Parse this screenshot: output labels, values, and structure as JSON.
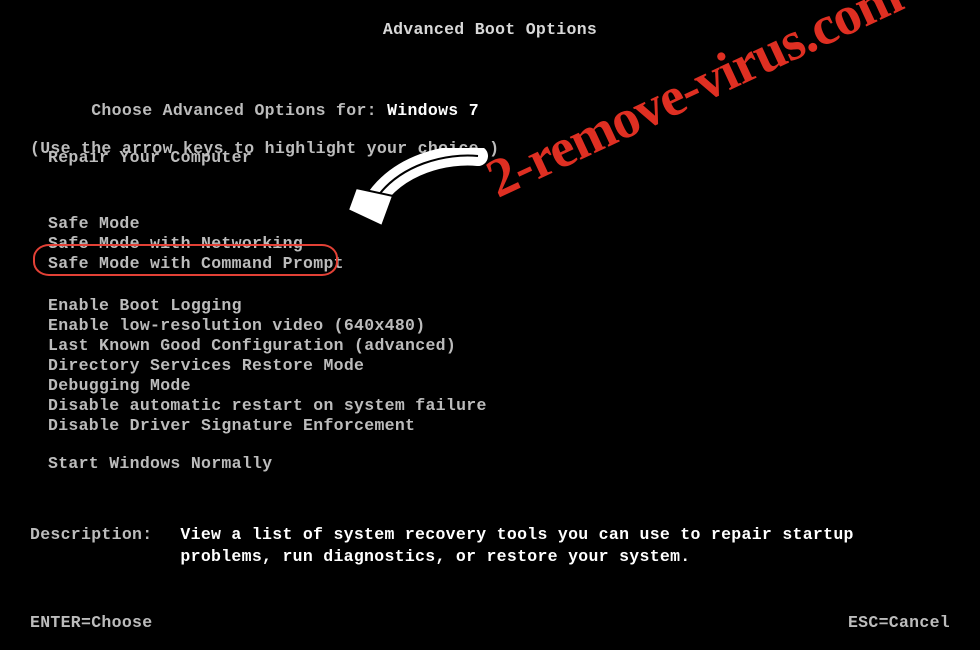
{
  "title": "Advanced Boot Options",
  "intro": {
    "line1_prefix": "Choose Advanced Options for: ",
    "os": "Windows 7",
    "line2": "(Use the arrow keys to highlight your choice.)"
  },
  "groups": {
    "repair": "Repair Your Computer",
    "safe": [
      "Safe Mode",
      "Safe Mode with Networking",
      "Safe Mode with Command Prompt"
    ],
    "misc": [
      "Enable Boot Logging",
      "Enable low-resolution video (640x480)",
      "Last Known Good Configuration (advanced)",
      "Directory Services Restore Mode",
      "Debugging Mode",
      "Disable automatic restart on system failure",
      "Disable Driver Signature Enforcement"
    ],
    "normal": "Start Windows Normally"
  },
  "description": {
    "label": "Description:",
    "text": "View a list of system recovery tools you can use to repair startup problems, run diagnostics, or restore your system."
  },
  "footer": {
    "enter": "ENTER=Choose",
    "esc": "ESC=Cancel"
  },
  "watermark": "2-remove-virus.com"
}
